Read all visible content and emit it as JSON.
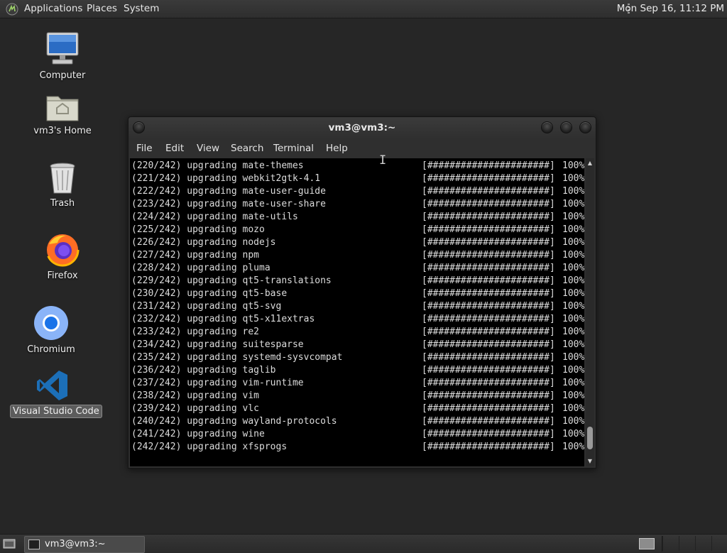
{
  "top_panel": {
    "menus": {
      "applications": "Applications",
      "places": "Places",
      "system": "System"
    },
    "clock": "Mon Sep 16, 11:12 PM"
  },
  "desktop": {
    "icons": [
      {
        "label": "Computer",
        "icon": "computer-icon"
      },
      {
        "label": "vm3's Home",
        "icon": "home-folder-icon"
      },
      {
        "label": "Trash",
        "icon": "trash-icon"
      },
      {
        "label": "Firefox",
        "icon": "firefox-icon"
      },
      {
        "label": "Chromium",
        "icon": "chromium-icon"
      },
      {
        "label": "Visual Studio Code",
        "icon": "vscode-icon",
        "selected": true
      }
    ]
  },
  "terminal_window": {
    "title": "vm3@vm3:~",
    "menu": {
      "file": "File",
      "edit": "Edit",
      "view": "View",
      "search": "Search",
      "terminal": "Terminal",
      "help": "Help"
    },
    "lines": [
      {
        "label": "(220/242) upgrading mate-themes",
        "bar": "[######################]",
        "percent": "100%"
      },
      {
        "label": "(221/242) upgrading webkit2gtk-4.1",
        "bar": "[######################]",
        "percent": "100%"
      },
      {
        "label": "(222/242) upgrading mate-user-guide",
        "bar": "[######################]",
        "percent": "100%"
      },
      {
        "label": "(223/242) upgrading mate-user-share",
        "bar": "[######################]",
        "percent": "100%"
      },
      {
        "label": "(224/242) upgrading mate-utils",
        "bar": "[######################]",
        "percent": "100%"
      },
      {
        "label": "(225/242) upgrading mozo",
        "bar": "[######################]",
        "percent": "100%"
      },
      {
        "label": "(226/242) upgrading nodejs",
        "bar": "[######################]",
        "percent": "100%"
      },
      {
        "label": "(227/242) upgrading npm",
        "bar": "[######################]",
        "percent": "100%"
      },
      {
        "label": "(228/242) upgrading pluma",
        "bar": "[######################]",
        "percent": "100%"
      },
      {
        "label": "(229/242) upgrading qt5-translations",
        "bar": "[######################]",
        "percent": "100%"
      },
      {
        "label": "(230/242) upgrading qt5-base",
        "bar": "[######################]",
        "percent": "100%"
      },
      {
        "label": "(231/242) upgrading qt5-svg",
        "bar": "[######################]",
        "percent": "100%"
      },
      {
        "label": "(232/242) upgrading qt5-x11extras",
        "bar": "[######################]",
        "percent": "100%"
      },
      {
        "label": "(233/242) upgrading re2",
        "bar": "[######################]",
        "percent": "100%"
      },
      {
        "label": "(234/242) upgrading suitesparse",
        "bar": "[######################]",
        "percent": "100%"
      },
      {
        "label": "(235/242) upgrading systemd-sysvcompat",
        "bar": "[######################]",
        "percent": "100%"
      },
      {
        "label": "(236/242) upgrading taglib",
        "bar": "[######################]",
        "percent": "100%"
      },
      {
        "label": "(237/242) upgrading vim-runtime",
        "bar": "[######################]",
        "percent": "100%"
      },
      {
        "label": "(238/242) upgrading vim",
        "bar": "[######################]",
        "percent": "100%"
      },
      {
        "label": "(239/242) upgrading vlc",
        "bar": "[######################]",
        "percent": "100%"
      },
      {
        "label": "(240/242) upgrading wayland-protocols",
        "bar": "[######################]",
        "percent": "100%"
      },
      {
        "label": "(241/242) upgrading wine",
        "bar": "[######################]",
        "percent": "100%"
      },
      {
        "label": "(242/242) upgrading xfsprogs",
        "bar": "[######################]",
        "percent": "100%"
      }
    ]
  },
  "bottom_panel": {
    "task_label": "vm3@vm3:~"
  },
  "colors": {
    "desktop_bg": "#262626",
    "panel_bg": "#2e2e2e",
    "terminal_bg": "#000000",
    "terminal_fg": "#dcdcdc",
    "selection_bg": "#5c5c5c"
  }
}
